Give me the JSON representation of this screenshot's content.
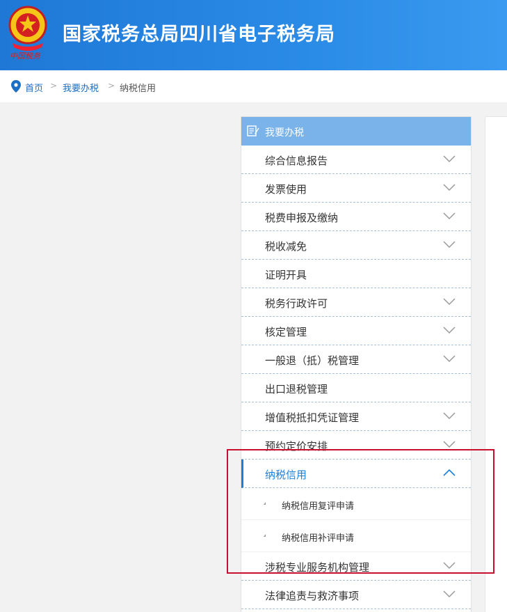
{
  "header": {
    "site_title": "国家税务总局四川省电子税务局",
    "logo_text": "中国税务"
  },
  "breadcrumb": {
    "home": "首页",
    "section": "我要办税",
    "current": "纳税信用",
    "separator": ">"
  },
  "menu": {
    "title": "我要办税",
    "items": [
      {
        "label": "综合信息报告",
        "has_arrow": true
      },
      {
        "label": "发票使用",
        "has_arrow": true
      },
      {
        "label": "税费申报及缴纳",
        "has_arrow": true
      },
      {
        "label": "税收减免",
        "has_arrow": true
      },
      {
        "label": "证明开具",
        "has_arrow": false
      },
      {
        "label": "税务行政许可",
        "has_arrow": true
      },
      {
        "label": "核定管理",
        "has_arrow": true
      },
      {
        "label": "一般退（抵）税管理",
        "has_arrow": true
      },
      {
        "label": "出口退税管理",
        "has_arrow": false
      },
      {
        "label": "增值税抵扣凭证管理",
        "has_arrow": true
      },
      {
        "label": "预约定价安排",
        "has_arrow": true
      },
      {
        "label": "纳税信用",
        "has_arrow": true,
        "expanded": true
      },
      {
        "label": "涉税专业服务机构管理",
        "has_arrow": true
      },
      {
        "label": "法律追责与救济事项",
        "has_arrow": true
      }
    ],
    "sub_items": [
      {
        "label": "纳税信用复评申请"
      },
      {
        "label": "纳税信用补评申请"
      }
    ]
  },
  "colors": {
    "header_blue": "#2a8be6",
    "menu_header": "#7ab3ea",
    "active": "#1a7fd9",
    "highlight": "#c8102e"
  }
}
